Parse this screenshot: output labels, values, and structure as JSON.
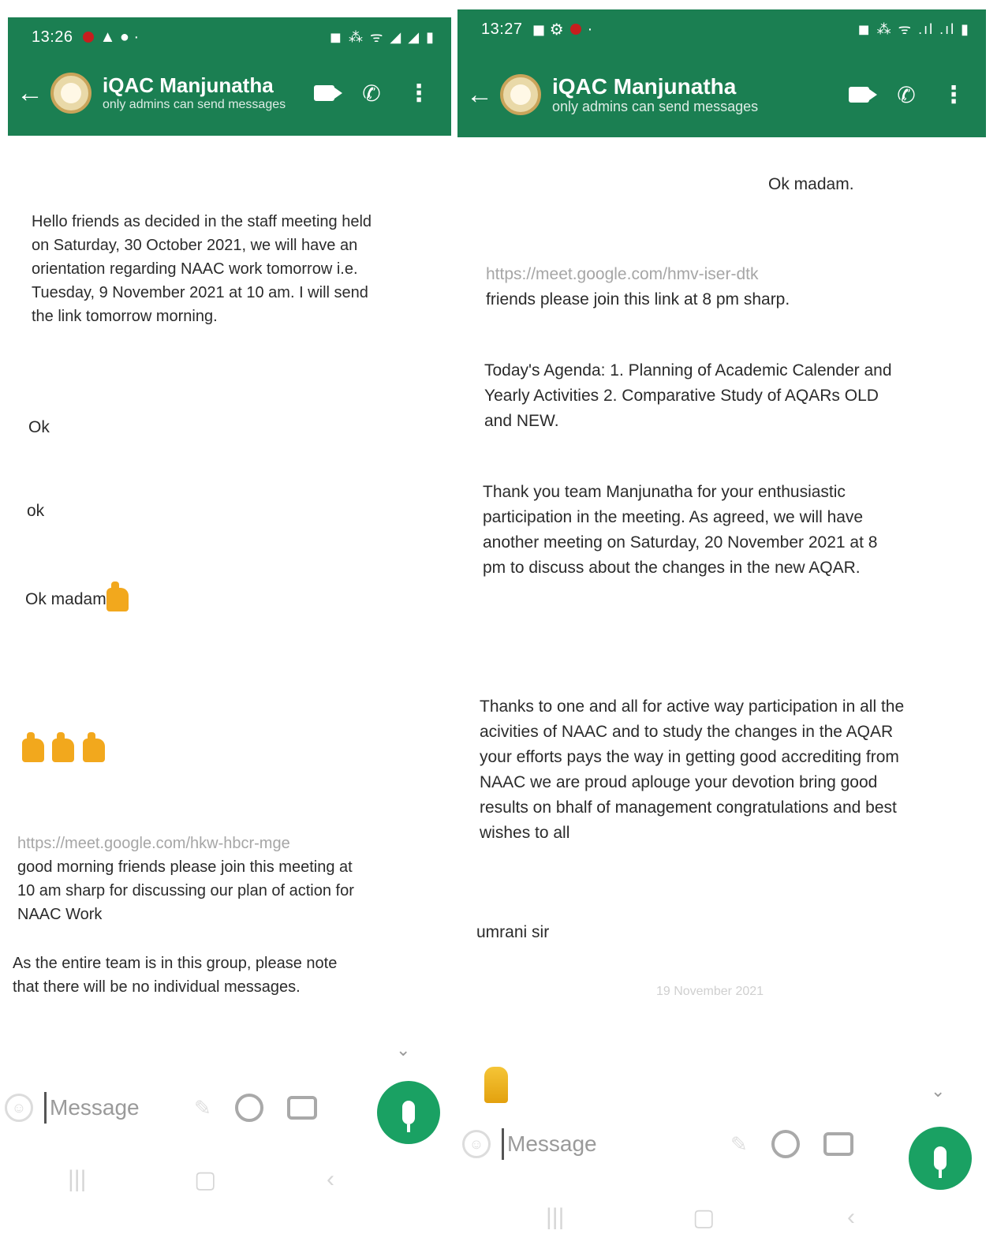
{
  "left": {
    "status": {
      "time": "13:26",
      "icons": "◼ ⁂ ᯤ ◢ ◢ ▮"
    },
    "header": {
      "title": "iQAC Manjunatha",
      "subtitle": "only admins can send messages"
    },
    "messages": [
      {
        "text": "Hello friends as decided in the staff meeting held on Saturday, 30 October 2021, we will have an orientation regarding NAAC work tomorrow i.e. Tuesday, 9 November 2021 at 10 am. I will send the link tomorrow morning."
      },
      {
        "text": "Ok"
      },
      {
        "text": "ok"
      },
      {
        "text": "Ok madam"
      },
      {
        "link": "https://meet.google.com/hkw-hbcr-mge",
        "text": "good morning friends please join this meeting at 10 am sharp for discussing our plan of action for NAAC Work"
      },
      {
        "text": "As the entire team is in this group, please note that there will be no individual messages."
      }
    ],
    "input": {
      "placeholder": "Message"
    }
  },
  "right": {
    "status": {
      "time": "13:27",
      "icons": "◼ ⁂ ᯤ .ıl .ıl ▮"
    },
    "header": {
      "title": "iQAC Manjunatha",
      "subtitle": "only admins can send messages"
    },
    "messages": [
      {
        "text": "Ok madam."
      },
      {
        "link": "https://meet.google.com/hmv-iser-dtk",
        "text": "friends please join this link at 8 pm sharp."
      },
      {
        "text": "Today's Agenda: 1. Planning of Academic Calender and Yearly Activities 2. Comparative Study of AQARs OLD and NEW."
      },
      {
        "text": "Thank you team Manjunatha for your enthusiastic participation in the meeting. As agreed, we will have another meeting on Saturday, 20 November 2021 at 8 pm to discuss about the changes in the new AQAR."
      },
      {
        "text": "Thanks to one and all for active way participation in all the acivities of NAAC and to study the changes in the AQAR your efforts pays the  way in getting good accrediting from NAAC we are proud aplouge your devotion bring good results on bhalf of management congratulations and best wishes to all"
      },
      {
        "text": "umrani sir"
      }
    ],
    "date_separator": "19 November 2021",
    "input": {
      "placeholder": "Message"
    }
  },
  "colors": {
    "header_green": "#1b7f52",
    "mic_green": "#1aa163"
  },
  "icons": [
    "back-arrow-icon",
    "video-call-icon",
    "phone-icon",
    "more-vert-icon",
    "emoji-icon",
    "attach-icon",
    "payment-icon",
    "camera-icon",
    "mic-icon",
    "scroll-down-icon"
  ]
}
